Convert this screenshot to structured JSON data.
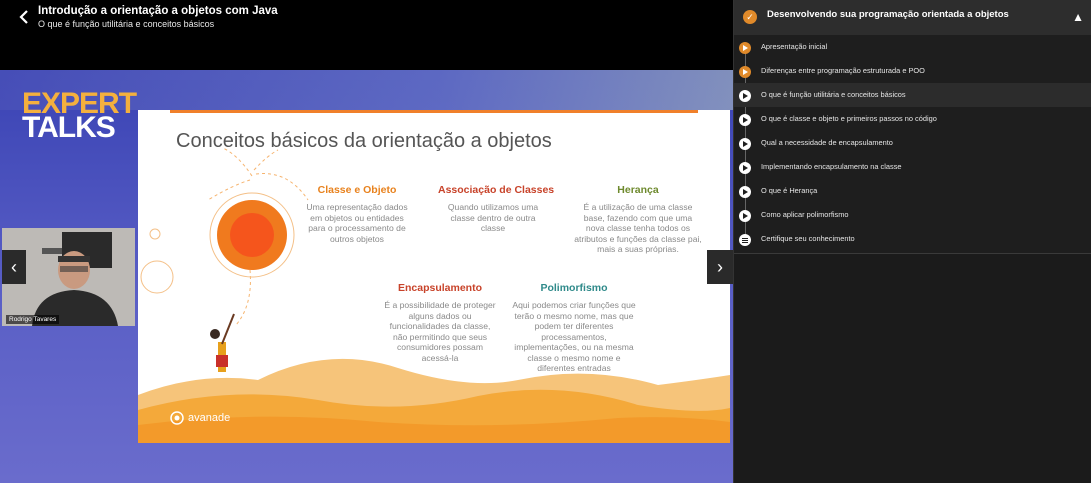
{
  "header": {
    "title": "Introdução a orientação a objetos com Java",
    "subtitle": "O que é função utilitária e conceitos básicos"
  },
  "video": {
    "brand_line1": "EXPERT",
    "brand_line2": "TALKS",
    "slide": {
      "title": "Conceitos básicos da orientação a objetos",
      "concepts": [
        {
          "title": "Classe e Objeto",
          "color": "#e8821e",
          "desc": "Uma representação dados em objetos ou entidades para o processamento de outros objetos"
        },
        {
          "title": "Associação de Classes",
          "color": "#c8432a",
          "desc": "Quando utilizamos uma classe dentro de outra classe"
        },
        {
          "title": "Herança",
          "color": "#6e8a2e",
          "desc": "É a utilização de uma classe base, fazendo com que uma nova classe tenha todos os atributos e funções da classe pai, mais a suas próprias."
        },
        {
          "title": "Encapsulamento",
          "color": "#c8432a",
          "desc": "É a possibilidade de proteger alguns dados ou funcionalidades da classe, não permitindo que seus consumidores possam acessá-la"
        },
        {
          "title": "Polimorfismo",
          "color": "#2f8a8a",
          "desc": "Aqui podemos criar funções que terão o mesmo nome, mas que podem ter diferentes processamentos, implementações, ou na mesma classe o mesmo nome e diferentes entradas"
        }
      ],
      "footer_brand": "avanade"
    },
    "webcam_name": "Rodrigo Tavares"
  },
  "sidebar": {
    "module_title": "Desenvolvendo sua programação orientada a objetos",
    "lessons": [
      {
        "label": "Apresentação inicial",
        "status": "done"
      },
      {
        "label": "Diferenças entre programação estruturada e POO",
        "status": "done"
      },
      {
        "label": "O que é função utilitária e conceitos básicos",
        "status": "active"
      },
      {
        "label": "O que é classe e objeto e primeiros passos no código",
        "status": "pending"
      },
      {
        "label": "Qual a necessidade de encapsulamento",
        "status": "pending"
      },
      {
        "label": "Implementando encapsulamento na classe",
        "status": "pending"
      },
      {
        "label": "O que é Herança",
        "status": "pending"
      },
      {
        "label": "Como aplicar polimorfismo",
        "status": "pending"
      },
      {
        "label": "Certifique seu conhecimento",
        "status": "quiz"
      }
    ]
  },
  "colors": {
    "accent": "#e08a2a",
    "sidebar_bg": "#1b1b1b",
    "video_bg": "#4a50bc"
  }
}
